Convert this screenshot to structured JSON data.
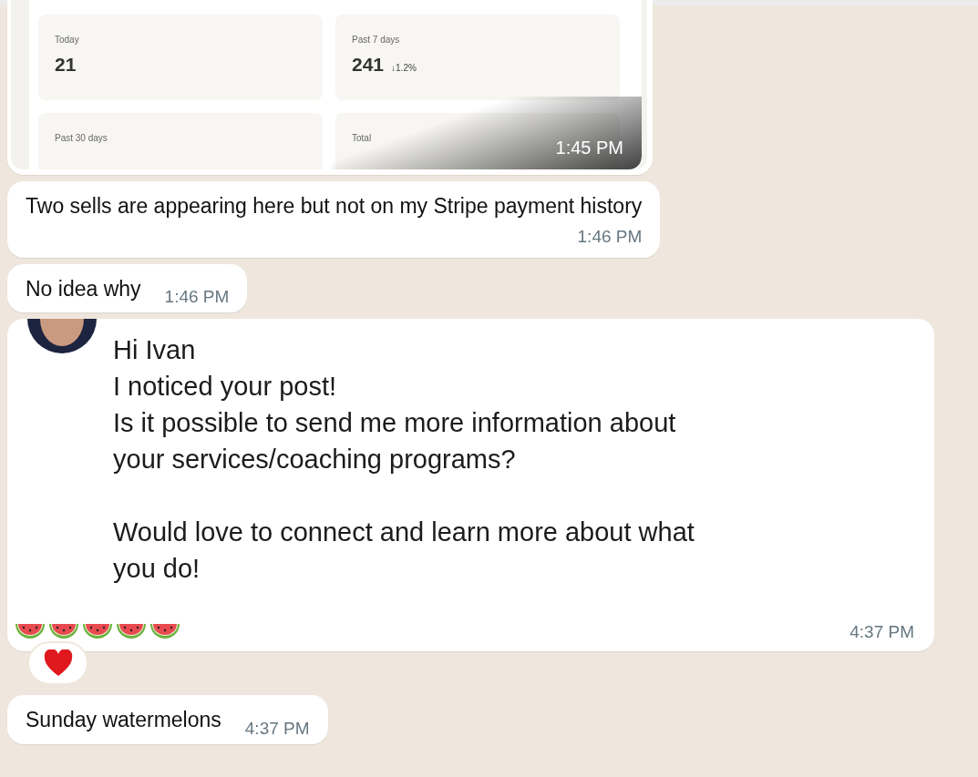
{
  "messages": [
    {
      "kind": "image",
      "stats": [
        {
          "label": "Today",
          "value": "21"
        },
        {
          "label": "Past 7 days",
          "value": "241",
          "change": "↓1.2%"
        },
        {
          "label": "Past 30 days"
        },
        {
          "label": "Total"
        }
      ],
      "time": "1:45 PM"
    },
    {
      "kind": "text",
      "text": "Two sells are appearing here but not on my Stripe payment history",
      "time": "1:46 PM",
      "inline_time": false
    },
    {
      "kind": "text",
      "text": "No idea why",
      "time": "1:46 PM",
      "inline_time": true
    },
    {
      "kind": "forwarded",
      "paragraphs": [
        "Hi Ivan\nI noticed your post!\nIs it possible to send me more information about\nyour services/coaching programs?",
        "Would love to connect and learn more about what\nyou do!"
      ],
      "emojis": [
        {
          "kind": "watermelon"
        },
        {
          "kind": "watermelon"
        },
        {
          "kind": "watermelon"
        },
        {
          "kind": "watermelon"
        },
        {
          "kind": "watermelon"
        }
      ],
      "reaction": {
        "kind": "heart"
      },
      "time": "4:37 PM"
    },
    {
      "kind": "text",
      "text": "Sunday watermelons",
      "time": "4:37 PM",
      "inline_time": true
    }
  ]
}
